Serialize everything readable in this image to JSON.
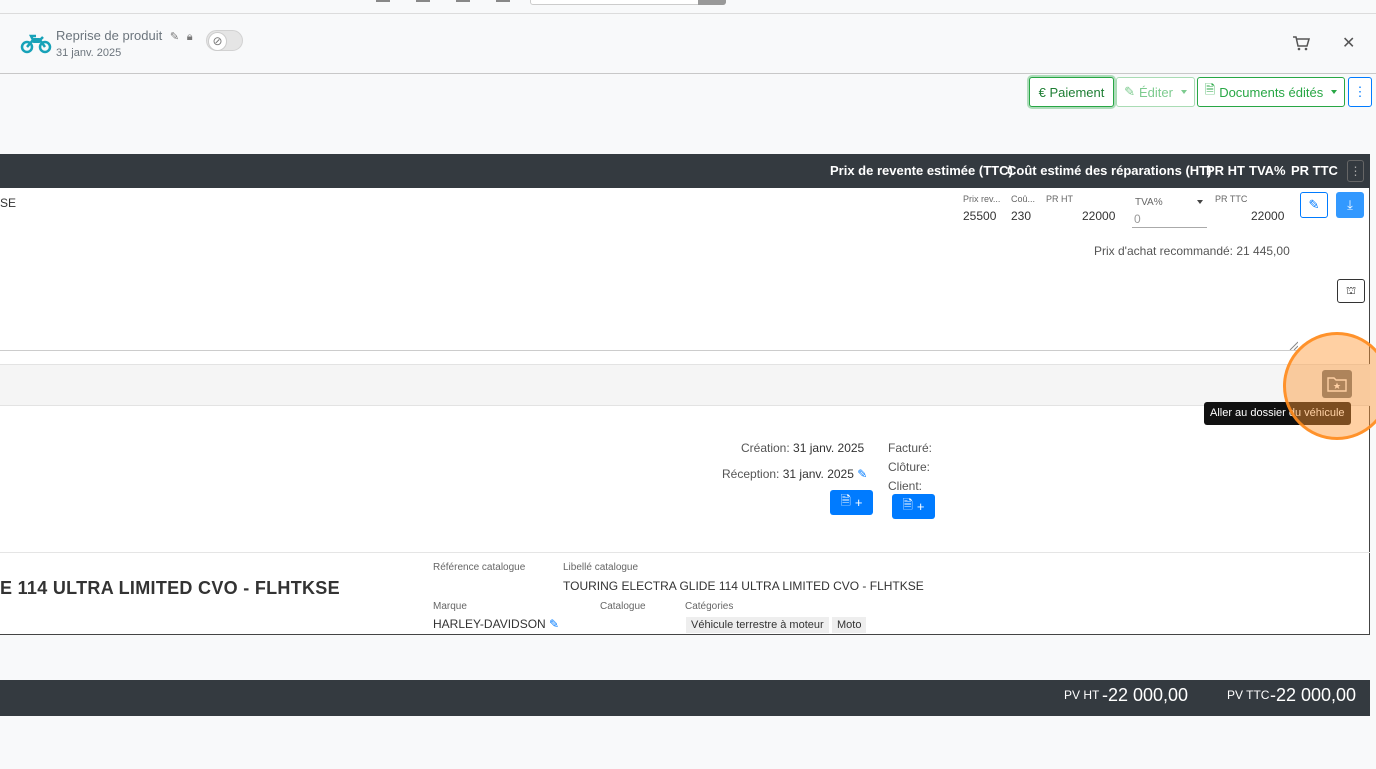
{
  "header": {
    "title": "Reprise de produit",
    "date": "31 janv. 2025"
  },
  "toolbar": {
    "payment_label": "€ Paiement",
    "edit_label": "Éditer",
    "documents_label": "Documents édités"
  },
  "table": {
    "headers": [
      "Prix de revente estimée (TTC)",
      "Coût estimé des réparations (HT)",
      "PR HT",
      "TVA%",
      "PR TTC"
    ],
    "row_text": "SE",
    "mini_labels": {
      "prix_revente": "Prix rev...",
      "cout": "Coû...",
      "pr_ht": "PR HT",
      "tva": "TVA%",
      "pr_ttc": "PR TTC"
    },
    "values": {
      "prix_revente": "25500",
      "cout": "230",
      "pr_ht": "22000",
      "tva": "0",
      "pr_ttc": "22000"
    },
    "recommended_label": "Prix d'achat recommandé: 21 445,00"
  },
  "tooltip": "Aller au dossier du véhicule",
  "info": {
    "creation_label": "Création:",
    "creation_value": "31 janv. 2025",
    "reception_label": "Réception:",
    "reception_value": "31 janv. 2025",
    "facture_label": "Facturé:",
    "cloture_label": "Clôture:",
    "client_label": "Client:"
  },
  "product": {
    "title": "E 114 ULTRA LIMITED CVO - FLHTKSE",
    "ref_catalogue_label": "Référence catalogue",
    "libelle_catalogue_label": "Libellé catalogue",
    "libelle_catalogue_value": "TOURING ELECTRA GLIDE 114 ULTRA LIMITED CVO - FLHTKSE",
    "marque_label": "Marque",
    "marque_value": "HARLEY-DAVIDSON",
    "catalogue_label": "Catalogue",
    "categories_label": "Catégories",
    "categories": [
      "Véhicule terrestre à moteur",
      "Moto"
    ]
  },
  "footer": {
    "pv_ht_label": "PV HT",
    "pv_ht_value": "-22 000,00",
    "pv_ttc_label": "PV TTC",
    "pv_ttc_value": "-22 000,00"
  },
  "colors": {
    "accent_green": "#28a745",
    "accent_blue": "#007bff",
    "dark_bar": "#343a40",
    "highlight": "#ff8c1e"
  }
}
